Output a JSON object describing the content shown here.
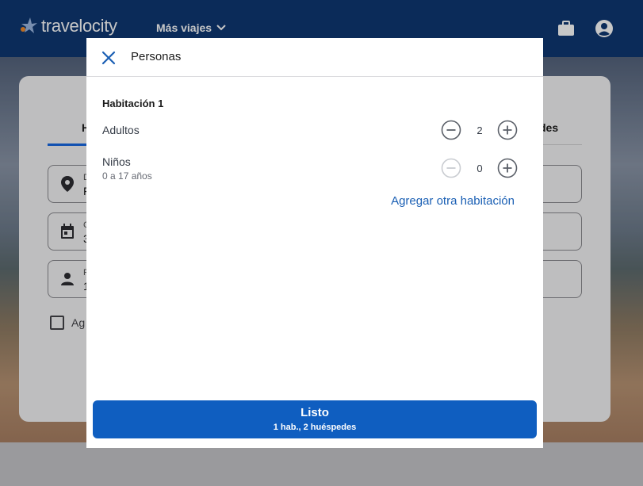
{
  "header": {
    "logo_text": "travelocity",
    "nav_more_label": "Más viajes",
    "icons": [
      "briefcase-icon",
      "account-icon"
    ],
    "bg_color": "#0f3873"
  },
  "search_card": {
    "tabs": [
      {
        "label": "H"
      },
      {
        "label": "des"
      }
    ],
    "fields": [
      {
        "icon": "location-pin-icon",
        "label": "D",
        "value": "F"
      },
      {
        "icon": "calendar-icon",
        "label": "C",
        "value": "3"
      },
      {
        "icon": "person-icon",
        "label": "P",
        "value": "1"
      }
    ],
    "checkbox_label": "Ag"
  },
  "modal": {
    "title": "Personas",
    "room_title": "Habitación 1",
    "adults": {
      "label": "Adultos",
      "value": "2"
    },
    "children": {
      "label": "Niños",
      "sublabel": "0 a 17 años",
      "value": "0"
    },
    "add_room_label": "Agregar otra habitación",
    "done_button": {
      "label": "Listo",
      "summary": "1 hab., 2 huéspedes"
    },
    "accent_color": "#0f5ec0"
  }
}
